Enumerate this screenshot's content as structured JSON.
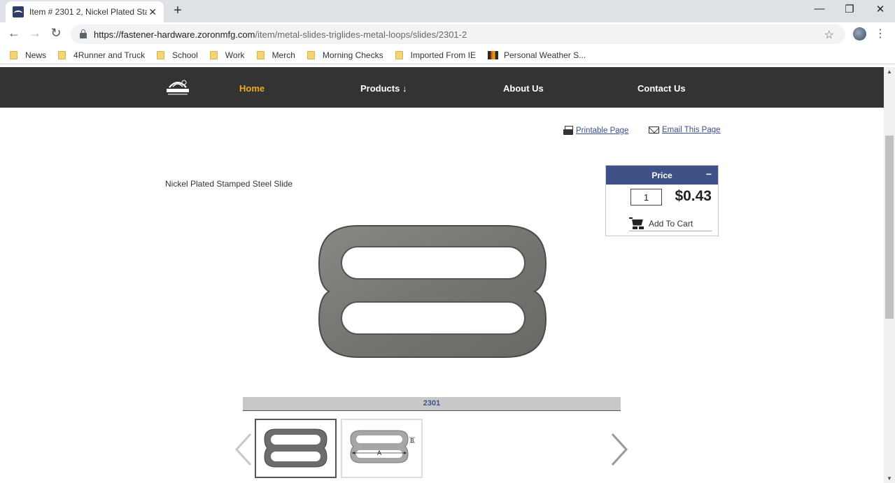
{
  "browser": {
    "tab": {
      "title": "Item # 2301 2, Nickel Plated Stam",
      "close_icon": "close-icon"
    },
    "new_tab_label": "+",
    "window_controls": {
      "minimize": "—",
      "restore": "❐",
      "close": "✕"
    },
    "nav": {
      "back": "←",
      "forward": "→",
      "reload": "↻"
    },
    "url": {
      "host": "https://fastener-hardware.zoronmfg.com",
      "path": "/item/metal-slides-triglides-metal-loops/slides/2301-2"
    },
    "star": "☆",
    "menu": "⋮",
    "bookmarks": [
      {
        "label": "News",
        "icon": "folder-icon"
      },
      {
        "label": "4Runner and Truck",
        "icon": "folder-icon"
      },
      {
        "label": "School",
        "icon": "folder-icon"
      },
      {
        "label": "Work",
        "icon": "folder-icon"
      },
      {
        "label": "Merch",
        "icon": "folder-icon"
      },
      {
        "label": "Morning Checks",
        "icon": "folder-icon"
      },
      {
        "label": "Imported From IE",
        "icon": "folder-icon"
      },
      {
        "label": "Personal Weather S...",
        "icon": "weather-icon"
      }
    ]
  },
  "site": {
    "nav": {
      "home": "Home",
      "products": "Products ↓",
      "about": "About Us",
      "contact": "Contact Us"
    },
    "utility": {
      "printable": "Printable Page",
      "email": "Email This Page"
    },
    "product": {
      "description": "Nickel Plated Stamped Steel Slide",
      "item_number": "2301"
    },
    "pricing": {
      "header": "Price",
      "collapse": "−",
      "quantity": "1",
      "price": "$0.43",
      "add_to_cart": "Add To Cart"
    },
    "thumbnails": {
      "dimension_a": "A",
      "dimension_b": "B"
    },
    "colors": {
      "nav_bg": "#333333",
      "nav_active": "#f0a81e",
      "price_header": "#3e5288",
      "link": "#3b4f8c"
    }
  }
}
